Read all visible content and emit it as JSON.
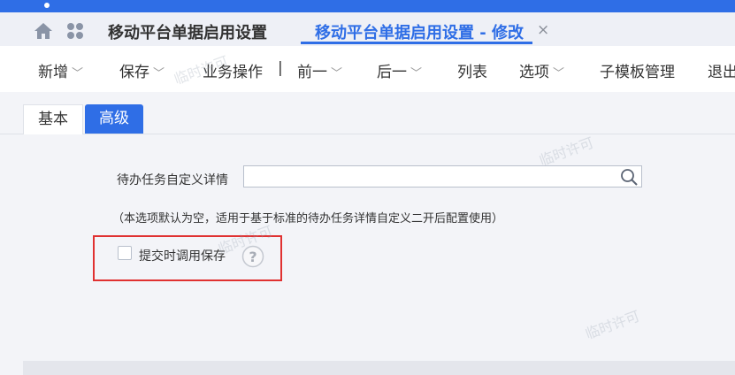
{
  "tabs": {
    "home_icon": "home-icon",
    "apps_icon": "apps-icon",
    "tab1_label": "移动平台单据启用设置",
    "tab2_label": "移动平台单据启用设置 - 修改",
    "close_glyph": "×"
  },
  "toolbar": {
    "new": "新增",
    "save": "保存",
    "business_ops": "业务操作",
    "separator": "|",
    "prev": "前一",
    "next": "后一",
    "list": "列表",
    "options": "选项",
    "sub_template": "子模板管理",
    "exit": "退出"
  },
  "subtabs": {
    "basic": "基本",
    "advanced": "高级"
  },
  "form": {
    "todo_detail_label": "待办任务自定义详情",
    "todo_detail_value": "",
    "note": "（本选项默认为空，适用于基于标准的待办任务详情自定义二开后配置使用）",
    "checkbox_label": "提交时调用保存",
    "checkbox_checked": false
  },
  "watermark": "临时许可",
  "colors": {
    "accent": "#2f6ee6",
    "highlight": "#e03131"
  }
}
